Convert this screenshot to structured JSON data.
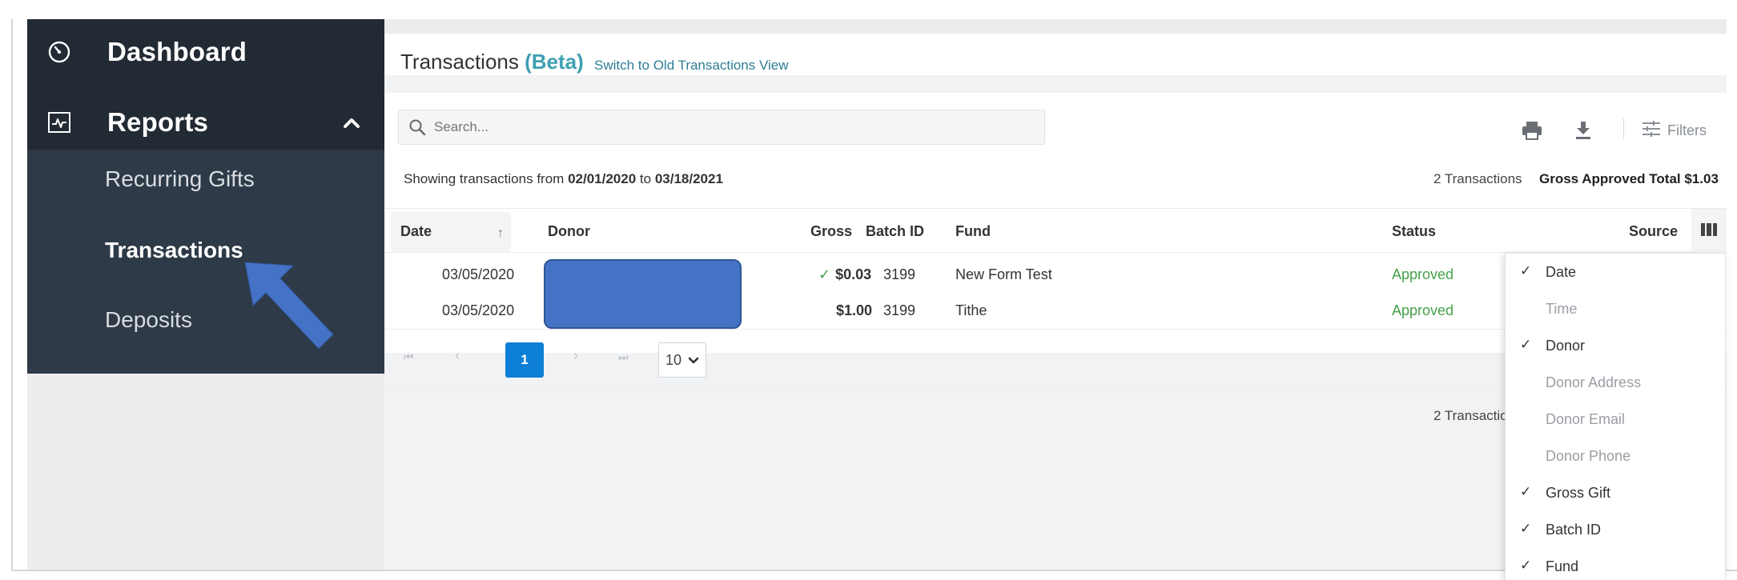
{
  "sidebar": {
    "dashboard_label": "Dashboard",
    "reports_label": "Reports",
    "sub_items": [
      "Recurring Gifts",
      "Transactions",
      "Deposits"
    ],
    "active_sub_item": "Transactions"
  },
  "header": {
    "title": "Transactions",
    "title_badge": "(Beta)",
    "switch_link": "Switch to Old Transactions View"
  },
  "toolbar": {
    "search_placeholder": "Search...",
    "filters_label": "Filters",
    "icons": [
      "print-icon",
      "download-icon",
      "filters-icon"
    ]
  },
  "summary": {
    "showing_prefix": "Showing transactions from",
    "date_from": "02/01/2020",
    "to_word": "to",
    "date_to": "03/18/2021",
    "transaction_count": "2 Transactions",
    "gross_total": "Gross Approved Total $1.03"
  },
  "table": {
    "columns": [
      "Date",
      "Donor",
      "Gross",
      "Batch ID",
      "Fund",
      "Status",
      "Source"
    ],
    "rows": [
      {
        "date": "03/05/2020",
        "donor": "",
        "gross": "$0.03",
        "gross_check": "✓",
        "batch_id": "3199",
        "fund": "New Form Test",
        "status": "Approved"
      },
      {
        "date": "03/05/2020",
        "donor": "",
        "gross": "$1.00",
        "gross_check": "",
        "batch_id": "3199",
        "fund": "Tithe",
        "status": "Approved"
      }
    ]
  },
  "pagination": {
    "first": "⏮",
    "prev": "‹",
    "current_page": "1",
    "next": "›",
    "last": "⏭",
    "page_size": "10"
  },
  "footer": {
    "transaction_count": "2 Transactio"
  },
  "column_menu": {
    "items": [
      {
        "label": "Date",
        "checked": "✓"
      },
      {
        "label": "Time",
        "checked": ""
      },
      {
        "label": "Donor",
        "checked": "✓"
      },
      {
        "label": "Donor Address",
        "checked": ""
      },
      {
        "label": "Donor Email",
        "checked": ""
      },
      {
        "label": "Donor Phone",
        "checked": ""
      },
      {
        "label": "Gross Gift",
        "checked": "✓"
      },
      {
        "label": "Batch ID",
        "checked": "✓"
      },
      {
        "label": "Fund",
        "checked": "✓"
      }
    ]
  },
  "colors": {
    "sidebar_dark": "#222a33",
    "sidebar_sub": "#2e3a47",
    "accent_beta": "#3fa0b2",
    "status_approved": "#44a24a",
    "page_active": "#0d7fd6",
    "annotation_arrow": "#4472c4"
  }
}
